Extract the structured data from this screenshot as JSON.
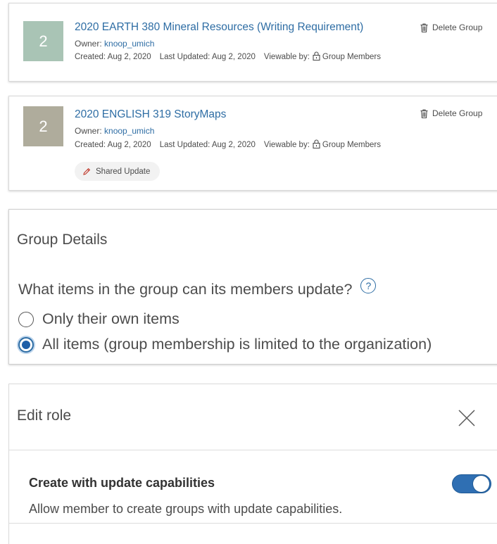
{
  "groups": [
    {
      "thumb_label": "2",
      "thumb_color": "#a9c4b5",
      "title": "2020 EARTH 380 Mineral Resources (Writing Requirement)",
      "owner_prefix": "Owner: ",
      "owner": "knoop_umich",
      "created": "Created: Aug 2, 2020",
      "updated": "Last Updated: Aug 2, 2020",
      "viewable_prefix": "Viewable by:",
      "viewable": "Group Members",
      "delete_label": "Delete Group"
    },
    {
      "thumb_label": "2",
      "thumb_color": "#afac9c",
      "title": "2020 ENGLISH 319 StoryMaps",
      "owner_prefix": "Owner: ",
      "owner": "knoop_umich",
      "created": "Created: Aug 2, 2020",
      "updated": "Last Updated: Aug 2, 2020",
      "viewable_prefix": "Viewable by:",
      "viewable": "Group Members",
      "delete_label": "Delete Group",
      "badge": "Shared Update"
    }
  ],
  "group_details": {
    "title": "Group Details",
    "question": "What items in the group can its members update?",
    "help_symbol": "?",
    "options": [
      {
        "label": "Only their own items",
        "selected": false
      },
      {
        "label": "All items (group membership is limited to the organization)",
        "selected": true
      }
    ]
  },
  "edit_role": {
    "title": "Edit role",
    "capability_title": "Create with update capabilities",
    "capability_description": "Allow member to create groups with update capabilities.",
    "toggle_on": true
  },
  "colors": {
    "link": "#2e6da4",
    "accent": "#2f6fb3",
    "text": "#4c4c4c"
  }
}
